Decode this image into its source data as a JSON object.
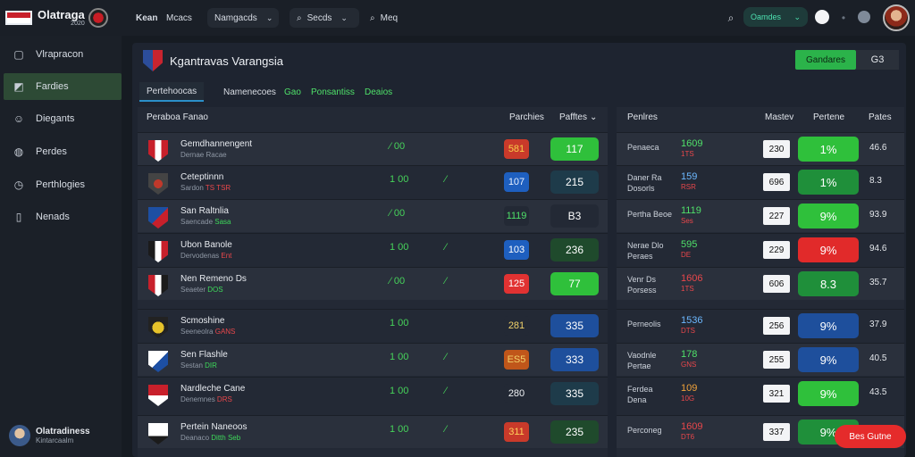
{
  "brand": {
    "name": "Olatraga",
    "sub": "2020"
  },
  "topnav": {
    "items": [
      "Kean",
      "Mcacs",
      "Namgacds",
      "Secds",
      "Meq"
    ]
  },
  "status": {
    "label": "Oamdes"
  },
  "sidebar": {
    "items": [
      {
        "label": "Vlrapracon",
        "icon": "list-icon"
      },
      {
        "label": "Fardies",
        "icon": "chart-icon"
      },
      {
        "label": "Diegants",
        "icon": "people-icon"
      },
      {
        "label": "Perdes",
        "icon": "ball-icon"
      },
      {
        "label": "Perthlogies",
        "icon": "clock-icon"
      },
      {
        "label": "Nenads",
        "icon": "doc-icon"
      }
    ],
    "user": {
      "name": "Olatradiness",
      "sub": "Kintarcaalm"
    }
  },
  "league": {
    "title": "Kgantravas Varangsia",
    "button": "Gandares",
    "count": "G3"
  },
  "tabs": [
    "Pertehoocas",
    "Namenecoes",
    "Gao",
    "Ponsantiss",
    "Deaios"
  ],
  "left_table": {
    "title": "Peraboa Fanao",
    "col1": "Parchies",
    "col2": "Pafftes",
    "rows": [
      {
        "name": "Gemdhannengent",
        "sub_a": "Dernae Racae",
        "sub_b": "",
        "trend1": "⁄ 00",
        "trend2": "",
        "chip": "581",
        "odds": "117"
      },
      {
        "name": "Ceteptinnn",
        "sub_a": "Sardon",
        "sub_b": "TS  TSR",
        "trend1": "1 00",
        "trend2": "⁄",
        "chip": "107",
        "odds": "215"
      },
      {
        "name": "San Raltnlia",
        "sub_a": "Saencade",
        "sub_b": "Sasa",
        "trend1": "⁄ 00",
        "trend2": "",
        "chip": "1119",
        "odds": "B3"
      },
      {
        "name": "Ubon Banole",
        "sub_a": "Dervodenas",
        "sub_b": "Ent",
        "trend1": "1 00",
        "trend2": "⁄",
        "chip": "103",
        "odds": "236"
      },
      {
        "name": "Nen Remeno Ds",
        "sub_a": "Seaeter",
        "sub_b": "DOS",
        "trend1": "⁄ 00",
        "trend2": "⁄",
        "chip": "125",
        "odds": "77"
      },
      {
        "name": "Scmoshine",
        "sub_a": "Seeneolra",
        "sub_b": "GANS",
        "trend1": "1 00",
        "trend2": "",
        "chip": "281",
        "odds": "335"
      },
      {
        "name": "Sen Flashle",
        "sub_a": "Sestan",
        "sub_b": "DIR",
        "trend1": "1 00",
        "trend2": "⁄",
        "chip": "ES5",
        "odds": "333"
      },
      {
        "name": "Nardleche Cane",
        "sub_a": "Denemnes",
        "sub_b": "DRS",
        "trend1": "1 00",
        "trend2": "⁄",
        "chip": "280",
        "odds": "335"
      },
      {
        "name": "Pertein Naneoos",
        "sub_a": "Deanaco",
        "sub_b": "Ditth Seb",
        "trend1": "1 00",
        "trend2": "⁄",
        "chip": "311",
        "odds": "235"
      }
    ]
  },
  "right_table": {
    "title": "Penlres",
    "col1": "Mastev",
    "col2": "Pertene",
    "col3": "Pates",
    "rows": [
      {
        "name": "Penaeca",
        "name2": "",
        "val": "1609",
        "valsub": "1TS",
        "white": "230",
        "pct": "1%",
        "num": "46.6"
      },
      {
        "name": "Daner Ra",
        "name2": "Dosorls",
        "val": "159",
        "valsub": "RSR",
        "white": "696",
        "pct": "1%",
        "num": "8.3"
      },
      {
        "name": "Pertha Beoe",
        "name2": "",
        "val": "1119",
        "valsub": "Ses",
        "white": "227",
        "pct": "9%",
        "num": "93.9"
      },
      {
        "name": "Nerae Dlo",
        "name2": "Peraes",
        "val": "595",
        "valsub": "DE",
        "white": "229",
        "pct": "9%",
        "num": "94.6"
      },
      {
        "name": "Venr Ds",
        "name2": "Porsess",
        "val": "1606",
        "valsub": "1TS",
        "white": "606",
        "pct": "8.3",
        "num": "35.7"
      },
      {
        "name": "Perneolis",
        "name2": "",
        "val": "1536",
        "valsub": "DTS",
        "white": "256",
        "pct": "9%",
        "num": "37.9"
      },
      {
        "name": "Vaodnle",
        "name2": "Pertae",
        "val": "178",
        "valsub": "GNS",
        "white": "255",
        "pct": "9%",
        "num": "40.5"
      },
      {
        "name": "Ferdea",
        "name2": "Dena",
        "val": "109",
        "valsub": "10G",
        "white": "321",
        "pct": "9%",
        "num": "43.5"
      },
      {
        "name": "Perconeg",
        "name2": "",
        "val": "1609",
        "valsub": "DT6",
        "white": "337",
        "pct": "9%",
        "num": ""
      }
    ]
  },
  "fab": {
    "label": "Bes Gutne"
  }
}
